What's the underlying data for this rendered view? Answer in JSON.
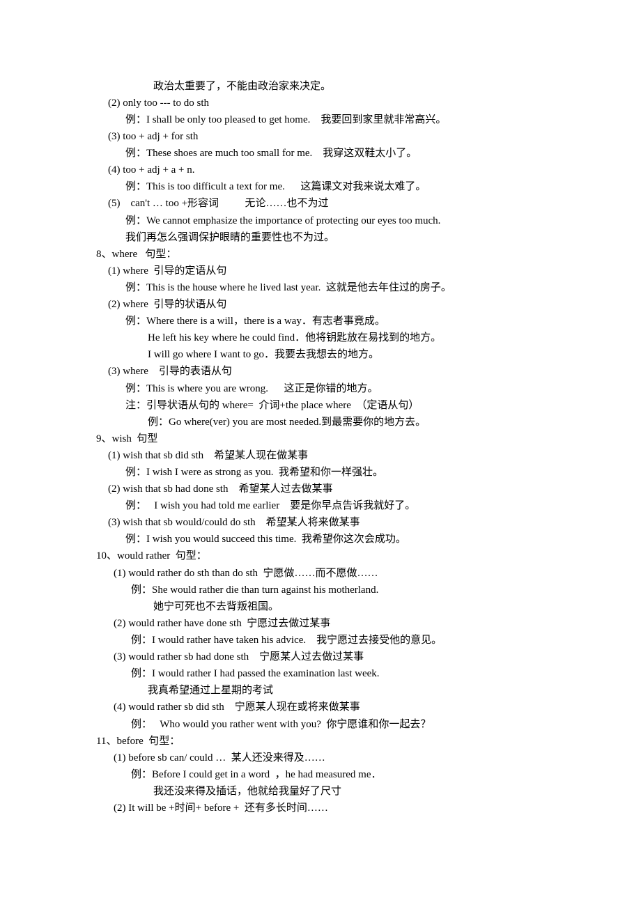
{
  "lines": [
    {
      "text": "政治太重要了，不能由政治家来决定。"
    },
    {
      "text": "(2) only too --- to do sth"
    },
    {
      "text": "例：I shall be only too pleased to get home.    我要回到家里就非常高兴。"
    },
    {
      "text": "(3) too + adj + for sth"
    },
    {
      "text": "例：These shoes are much too small for me.    我穿这双鞋太小了。"
    },
    {
      "text": "(4) too + adj + a + n."
    },
    {
      "text": "例：This is too difficult a text for me.      这篇课文对我来说太难了。"
    },
    {
      "text": "(5)    can't … too +形容词          无论……也不为过"
    },
    {
      "text": "例：We cannot emphasize the importance of protecting our eyes too much."
    },
    {
      "text": "我们再怎么强调保护眼睛的重要性也不为过。"
    },
    {
      "text": "8、where   句型："
    },
    {
      "text": "(1) where  引导的定语从句"
    },
    {
      "text": "例：This is the house where he lived last year.  这就是他去年住过的房子。"
    },
    {
      "text": "(2) where  引导的状语从句"
    },
    {
      "text": "例：Where there is a will，there is a way．有志者事竟成。"
    },
    {
      "text": "He left his key where he could find．他将钥匙放在易找到的地方。"
    },
    {
      "text": "I will go where I want to go．我要去我想去的地方。"
    },
    {
      "text": "(3) where    引导的表语从句"
    },
    {
      "text": "例：This is where you are wrong.      这正是你错的地方。"
    },
    {
      "text": "注：引导状语从句的 where=  介词+the place where  （定语从句）"
    },
    {
      "text": "例：Go where(ver) you are most needed.到最需要你的地方去。"
    },
    {
      "text": "9、wish  句型"
    },
    {
      "text": "(1) wish that sb did sth    希望某人现在做某事"
    },
    {
      "text": "例：I wish I were as strong as you.  我希望和你一样强壮。"
    },
    {
      "text": "(2) wish that sb had done sth    希望某人过去做某事"
    },
    {
      "text": "例：   I wish you had told me earlier    要是你早点告诉我就好了。"
    },
    {
      "text": "(3) wish that sb would/could do sth    希望某人将来做某事"
    },
    {
      "text": "例：I wish you would succeed this time.  我希望你这次会成功。"
    },
    {
      "text": "10、would rather  句型："
    },
    {
      "text": "(1) would rather do sth than do sth  宁愿做……而不愿做……"
    },
    {
      "text": "例：She would rather die than turn against his motherland."
    },
    {
      "text": "她宁可死也不去背叛祖国。"
    },
    {
      "text": "(2) would rather have done sth  宁愿过去做过某事"
    },
    {
      "text": "例：I would rather have taken his advice.    我宁愿过去接受他的意见。"
    },
    {
      "text": "(3) would rather sb had done sth    宁愿某人过去做过某事"
    },
    {
      "text": "例：I would rather I had passed the examination last week."
    },
    {
      "text": "我真希望通过上星期的考试"
    },
    {
      "text": "(4) would rather sb did sth    宁愿某人现在或将来做某事"
    },
    {
      "text": "例：   Who would you rather went with you?  你宁愿谁和你一起去？"
    },
    {
      "text": "11、before  句型："
    },
    {
      "text": "(1) before sb can/ could …  某人还没来得及……"
    },
    {
      "text": "例：Before I could get in a word  ，he had measured me．"
    },
    {
      "text": "我还没来得及插话，他就给我量好了尺寸"
    },
    {
      "text": "(2) It will be +时间+ before +  还有多长时间……"
    }
  ]
}
